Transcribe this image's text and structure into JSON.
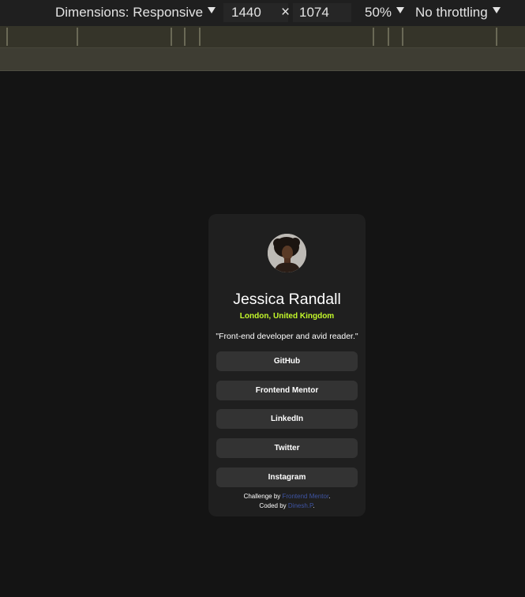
{
  "devtools": {
    "dimensions_label": "Dimensions: Responsive",
    "width": "1440",
    "times": "×",
    "height": "1074",
    "zoom": "50%",
    "throttling": "No throttling"
  },
  "profile": {
    "name": "Jessica Randall",
    "location": "London, United Kingdom",
    "bio": "\"Front-end developer and avid reader.\"",
    "links": [
      {
        "label": "GitHub"
      },
      {
        "label": "Frontend Mentor"
      },
      {
        "label": "LinkedIn"
      },
      {
        "label": "Twitter"
      },
      {
        "label": "Instagram"
      }
    ],
    "attribution": {
      "challenge_prefix": "Challenge by ",
      "challenge_link": "Frontend Mentor",
      "challenge_suffix": ".",
      "coded_prefix": "Coded by ",
      "coded_link": "Dinesh.P",
      "coded_suffix": "."
    }
  },
  "colors": {
    "accent_green": "#c4f82a",
    "link_blue": "#3e54a3",
    "card_bg": "#1f1f1f",
    "button_bg": "#333333"
  }
}
